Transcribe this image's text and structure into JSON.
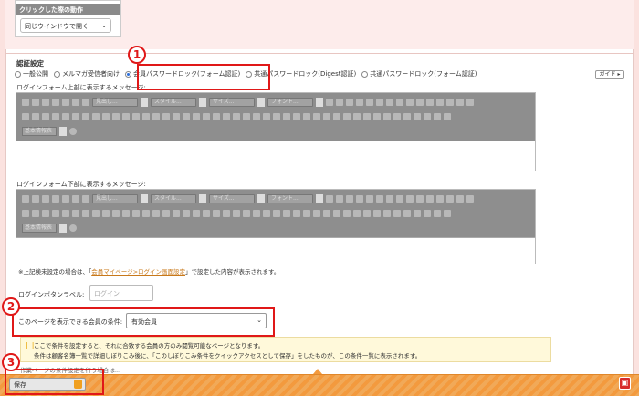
{
  "click_behavior": {
    "header": "クリックした際の動作",
    "value": "同じウインドウで開く"
  },
  "auth": {
    "title": "認証設定",
    "options": [
      {
        "label": "一般公開",
        "selected": false
      },
      {
        "label": "メルマガ受信者向け",
        "selected": false
      },
      {
        "label": "会員パスワードロック(フォーム認証)",
        "selected": true
      },
      {
        "label": "共通パスワードロック(Digest認証)",
        "selected": false
      },
      {
        "label": "共通パスワードロック(フォーム認証)",
        "selected": false
      }
    ],
    "guide_label": "ガイド"
  },
  "editor_top": {
    "label": "ログインフォーム上部に表示するメッセージ:",
    "dd1": "見出し...",
    "dd2": "スタイル...",
    "dd3": "サイズ...",
    "dd4": "フォント...",
    "dd5": "基本情報表"
  },
  "editor_bottom": {
    "label": "ログインフォーム下部に表示するメッセージ:",
    "dd1": "見出し...",
    "dd2": "スタイル...",
    "dd3": "サイズ...",
    "dd4": "フォント...",
    "dd5": "基本情報表"
  },
  "note": {
    "prefix": "※上記検未設定の場合は、「",
    "link": "会員マイページ>ログイン画面設定",
    "suffix": "」で設定した内容が表示されます。"
  },
  "login_button": {
    "label": "ログインボタンラベル:",
    "placeholder": "ログイン"
  },
  "condition": {
    "label": "このページを表示できる会員の条件:",
    "value": "有効会員"
  },
  "hint": {
    "line1": "ここで条件を設定すると、それに合致する会員の方のみ閲覧可能なページとなります。",
    "line2": "条件は顧客名簿一覧で詳細しぼりこみ後に、「このしぼりこみ条件をクイックアクセスとして保存」をしたものが、この条件一覧に表示されます。",
    "tail": "作業ページの条件設定を行う場合は..."
  },
  "footer": {
    "save_label": "保存"
  },
  "callouts": [
    "1",
    "2",
    "3"
  ],
  "colors": {
    "callout": "#e01818",
    "footer": "#f39a3e",
    "link": "#c8781a"
  }
}
